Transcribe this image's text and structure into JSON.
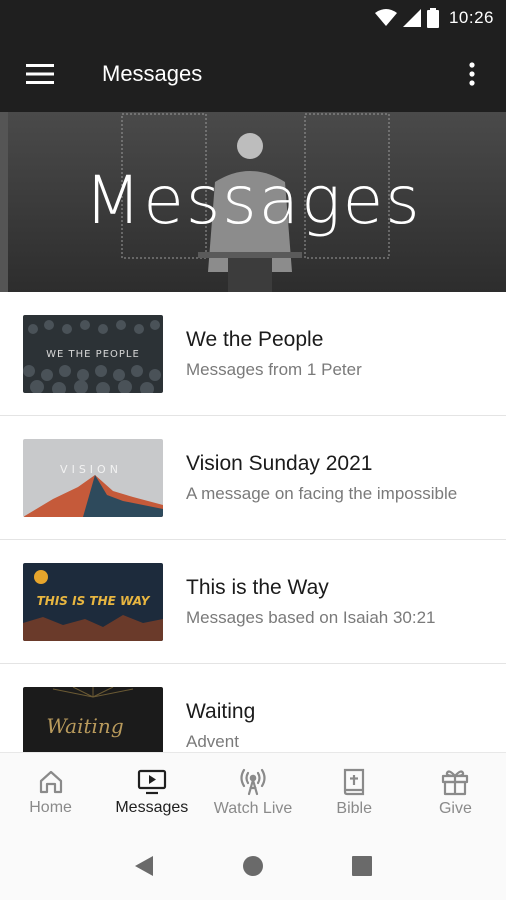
{
  "status": {
    "time": "10:26"
  },
  "app_bar": {
    "title": "Messages"
  },
  "hero": {
    "title": "Messages"
  },
  "list": [
    {
      "title": "We the People",
      "subtitle": "Messages from 1 Peter",
      "thumb_text": "WE THE PEOPLE"
    },
    {
      "title": "Vision Sunday 2021",
      "subtitle": "A message on facing the impossible",
      "thumb_text": "VISION"
    },
    {
      "title": "This is the Way",
      "subtitle": "Messages based on Isaiah 30:21",
      "thumb_text": "THIS IS THE WAY"
    },
    {
      "title": "Waiting",
      "subtitle": "Advent",
      "thumb_text": "Waiting"
    }
  ],
  "bottom_nav": [
    {
      "label": "Home",
      "icon": "home-icon"
    },
    {
      "label": "Messages",
      "icon": "tv-play-icon",
      "active": true
    },
    {
      "label": "Watch Live",
      "icon": "broadcast-icon"
    },
    {
      "label": "Bible",
      "icon": "bible-icon"
    },
    {
      "label": "Give",
      "icon": "gift-icon"
    }
  ],
  "colors": {
    "app_bar": "#1f1f1f",
    "active_nav": "#1f1f1f",
    "inactive_nav": "#8a8a8a"
  }
}
